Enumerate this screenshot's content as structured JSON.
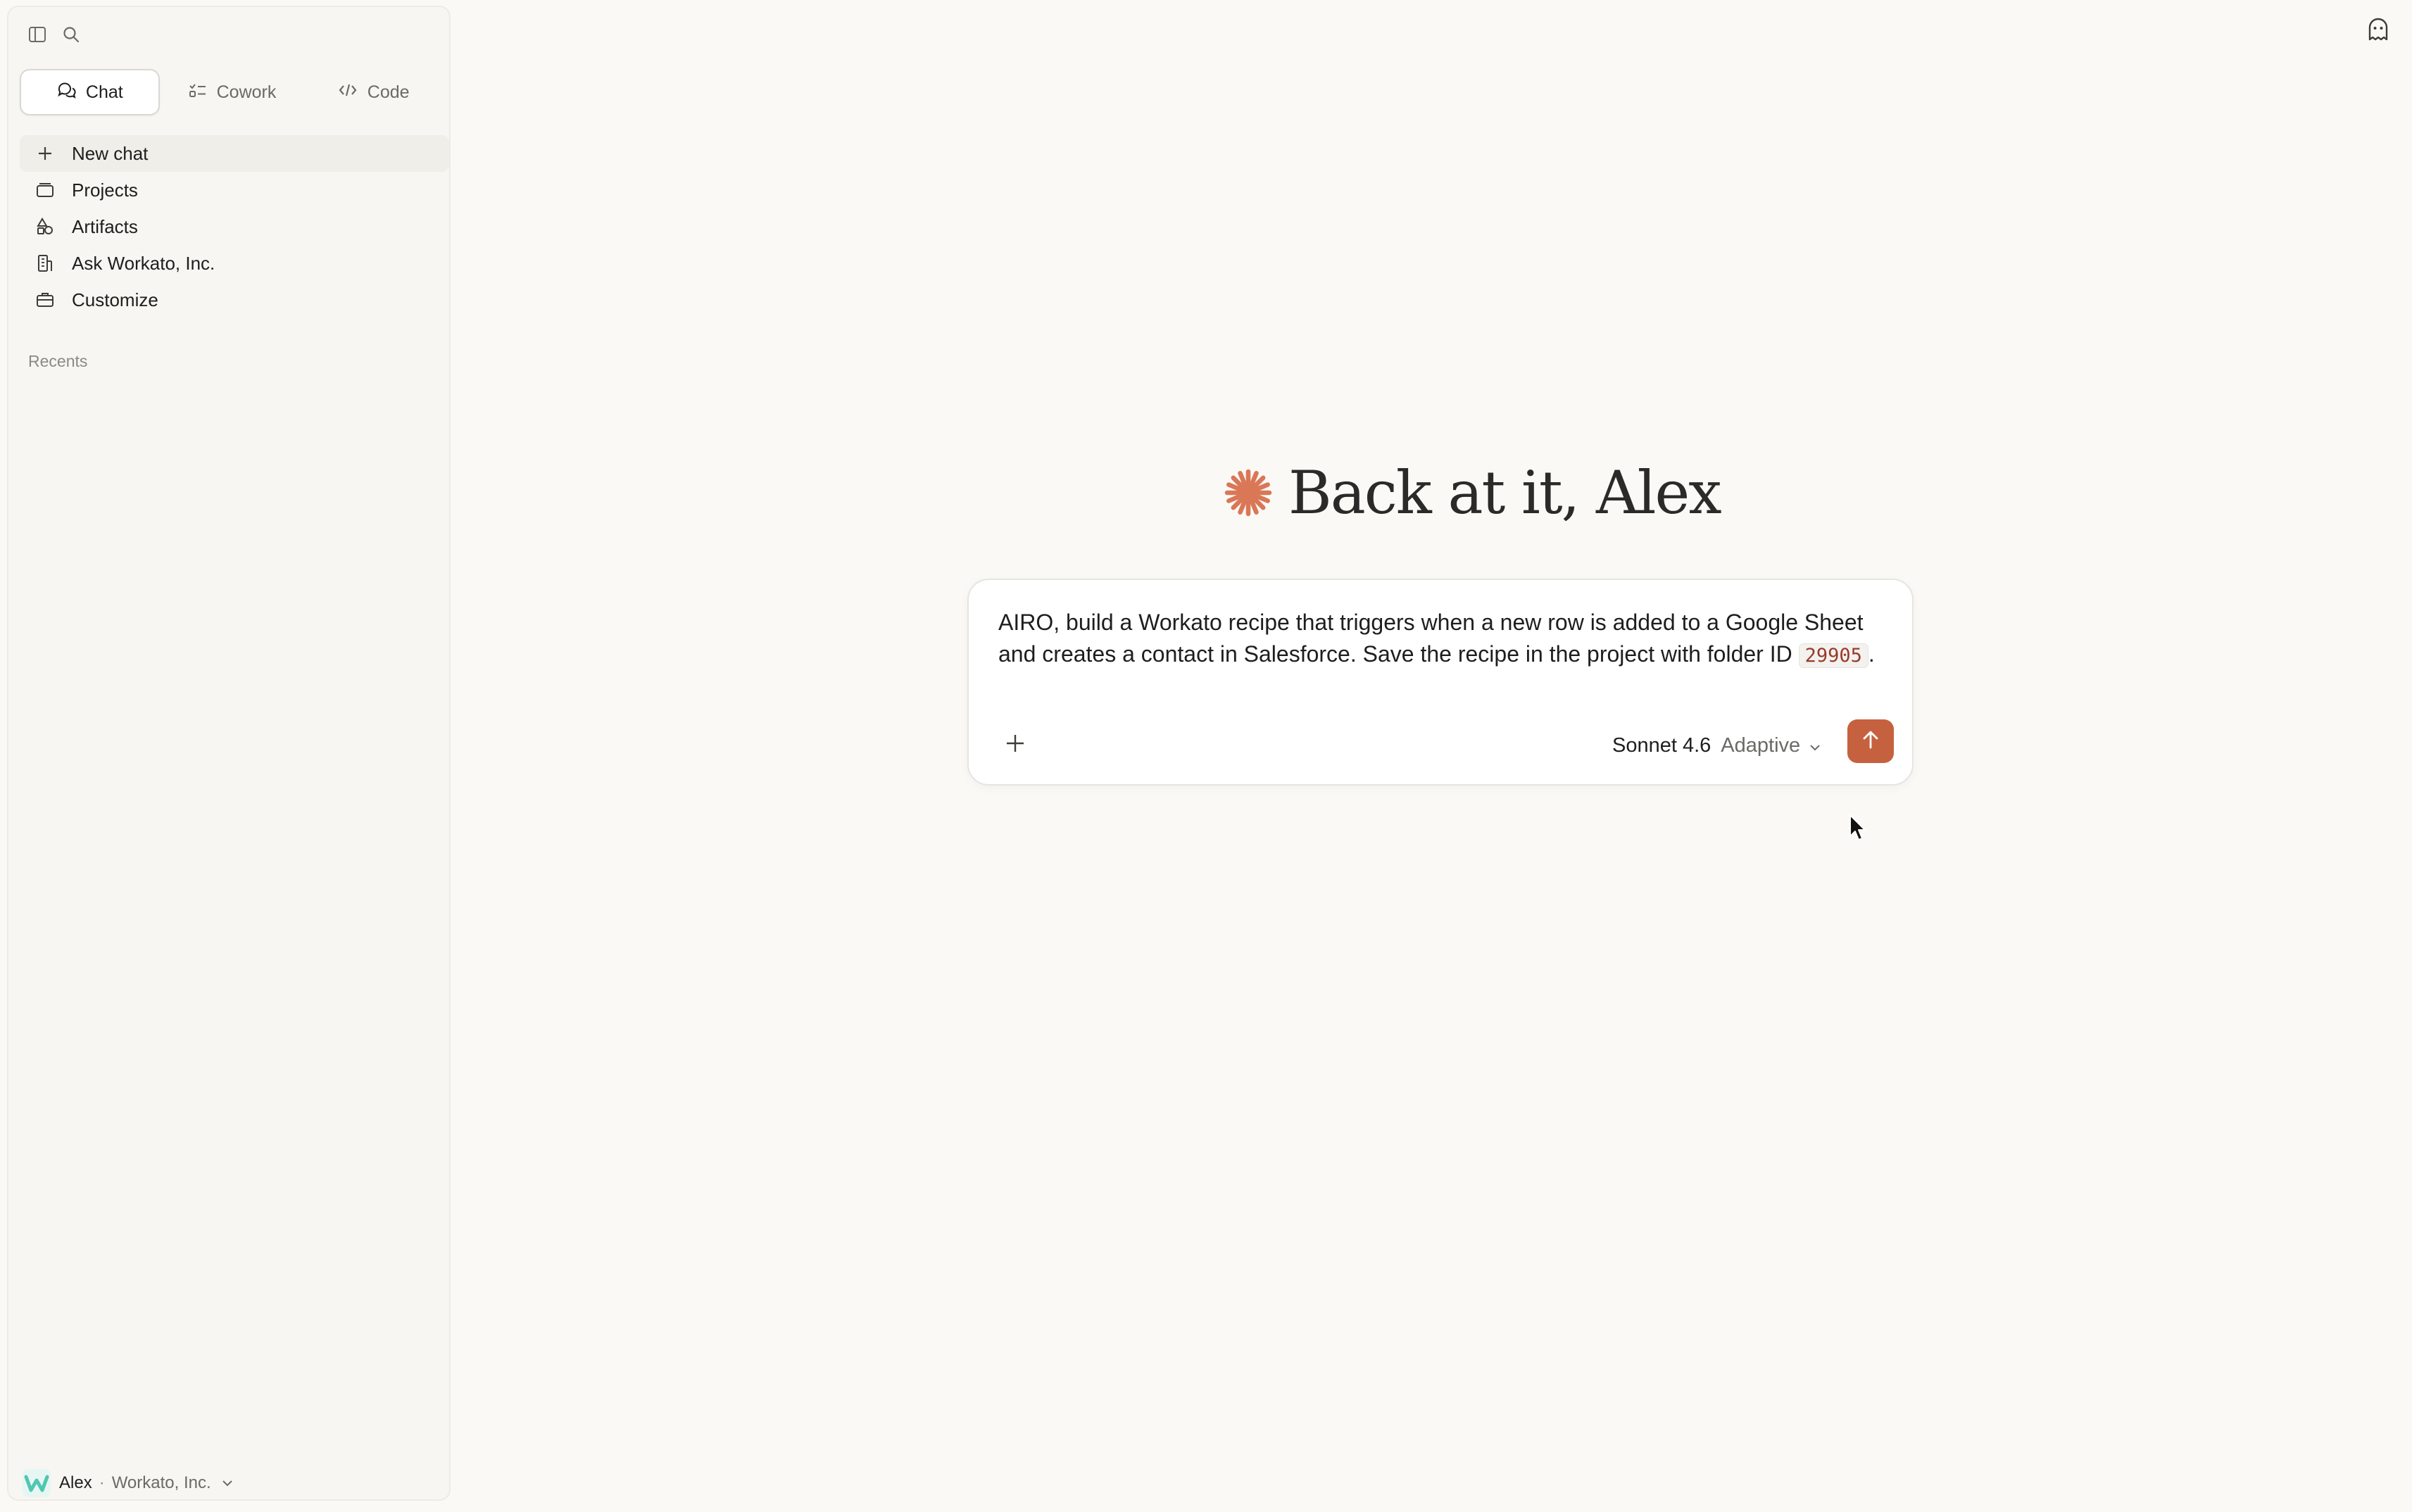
{
  "sidebar": {
    "toggle_icon": "sidebar-toggle-icon",
    "search_icon": "search-icon",
    "mode_tabs": [
      {
        "label": "Chat",
        "icon": "chat-bubble-icon",
        "active": true
      },
      {
        "label": "Cowork",
        "icon": "checklist-icon",
        "active": false
      },
      {
        "label": "Code",
        "icon": "code-brackets-icon",
        "active": false
      }
    ],
    "nav_items": [
      {
        "label": "New chat",
        "icon": "plus-icon",
        "active": true
      },
      {
        "label": "Projects",
        "icon": "folder-icon",
        "active": false
      },
      {
        "label": "Artifacts",
        "icon": "shapes-icon",
        "active": false
      },
      {
        "label": "Ask Workato, Inc.",
        "icon": "building-icon",
        "active": false
      },
      {
        "label": "Customize",
        "icon": "briefcase-icon",
        "active": false
      }
    ],
    "recents_label": "Recents",
    "user": {
      "name": "Alex",
      "separator": "·",
      "org": "Workato, Inc."
    }
  },
  "main": {
    "greeting": "Back at it, Alex",
    "composer": {
      "text_before": "AIRO, build a Workato recipe that triggers when a new row is added to a Google Sheet and creates a contact in Salesforce. Save the recipe in the project with folder ID ",
      "code": "29905",
      "text_after": ".",
      "model_name": "Sonnet 4.6",
      "model_mode": "Adaptive"
    }
  },
  "colors": {
    "accent": "#c6613f",
    "background": "#faf9f5",
    "sidebar": "#f7f6f2"
  }
}
